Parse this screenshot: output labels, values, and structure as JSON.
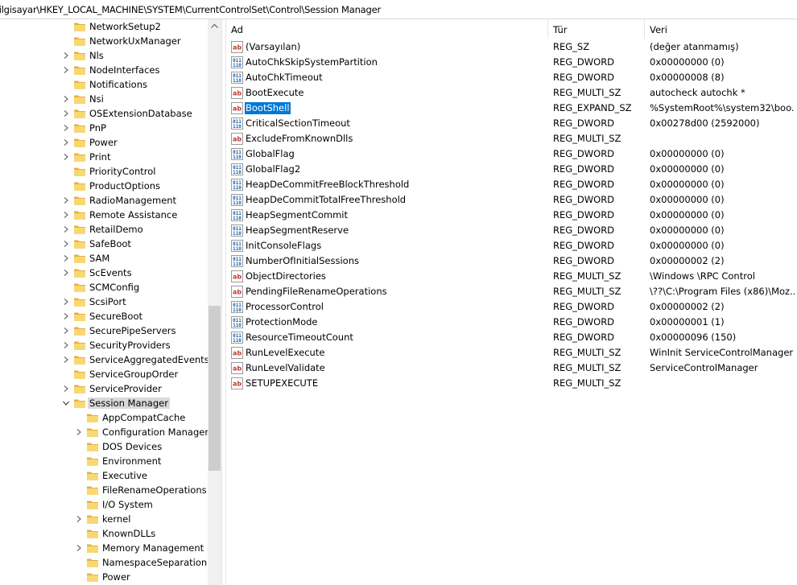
{
  "address": "Bilgisayar\\HKEY_LOCAL_MACHINE\\SYSTEM\\CurrentControlSet\\Control\\Session Manager",
  "tree": [
    {
      "label": "NetworkSetup2",
      "chev": "none",
      "lvl": 0
    },
    {
      "label": "NetworkUxManager",
      "chev": "none",
      "lvl": 0
    },
    {
      "label": "Nls",
      "chev": "right",
      "lvl": 0
    },
    {
      "label": "NodeInterfaces",
      "chev": "right",
      "lvl": 0
    },
    {
      "label": "Notifications",
      "chev": "none",
      "lvl": 0
    },
    {
      "label": "Nsi",
      "chev": "right",
      "lvl": 0
    },
    {
      "label": "OSExtensionDatabase",
      "chev": "right",
      "lvl": 0
    },
    {
      "label": "PnP",
      "chev": "right",
      "lvl": 0
    },
    {
      "label": "Power",
      "chev": "right",
      "lvl": 0
    },
    {
      "label": "Print",
      "chev": "right",
      "lvl": 0
    },
    {
      "label": "PriorityControl",
      "chev": "none",
      "lvl": 0
    },
    {
      "label": "ProductOptions",
      "chev": "none",
      "lvl": 0
    },
    {
      "label": "RadioManagement",
      "chev": "right",
      "lvl": 0
    },
    {
      "label": "Remote Assistance",
      "chev": "right",
      "lvl": 0
    },
    {
      "label": "RetailDemo",
      "chev": "right",
      "lvl": 0
    },
    {
      "label": "SafeBoot",
      "chev": "right",
      "lvl": 0
    },
    {
      "label": "SAM",
      "chev": "right",
      "lvl": 0
    },
    {
      "label": "ScEvents",
      "chev": "right",
      "lvl": 0
    },
    {
      "label": "SCMConfig",
      "chev": "none",
      "lvl": 0
    },
    {
      "label": "ScsiPort",
      "chev": "right",
      "lvl": 0
    },
    {
      "label": "SecureBoot",
      "chev": "right",
      "lvl": 0
    },
    {
      "label": "SecurePipeServers",
      "chev": "right",
      "lvl": 0
    },
    {
      "label": "SecurityProviders",
      "chev": "right",
      "lvl": 0
    },
    {
      "label": "ServiceAggregatedEvents",
      "chev": "right",
      "lvl": 0
    },
    {
      "label": "ServiceGroupOrder",
      "chev": "none",
      "lvl": 0
    },
    {
      "label": "ServiceProvider",
      "chev": "right",
      "lvl": 0
    },
    {
      "label": "Session Manager",
      "chev": "down",
      "lvl": 0,
      "selected": true
    },
    {
      "label": "AppCompatCache",
      "chev": "none",
      "lvl": 1
    },
    {
      "label": "Configuration Manager",
      "chev": "right",
      "lvl": 1
    },
    {
      "label": "DOS Devices",
      "chev": "none",
      "lvl": 1
    },
    {
      "label": "Environment",
      "chev": "none",
      "lvl": 1
    },
    {
      "label": "Executive",
      "chev": "none",
      "lvl": 1
    },
    {
      "label": "FileRenameOperations",
      "chev": "none",
      "lvl": 1
    },
    {
      "label": "I/O System",
      "chev": "none",
      "lvl": 1
    },
    {
      "label": "kernel",
      "chev": "right",
      "lvl": 1
    },
    {
      "label": "KnownDLLs",
      "chev": "none",
      "lvl": 1
    },
    {
      "label": "Memory Management",
      "chev": "right",
      "lvl": 1
    },
    {
      "label": "NamespaceSeparation",
      "chev": "none",
      "lvl": 1
    },
    {
      "label": "Power",
      "chev": "none",
      "lvl": 1
    }
  ],
  "columns": {
    "name": "Ad",
    "type": "Tür",
    "data": "Veri"
  },
  "values": [
    {
      "icon": "ab",
      "name": "(Varsayılan)",
      "type": "REG_SZ",
      "data": "(değer atanmamış)"
    },
    {
      "icon": "bin",
      "name": "AutoChkSkipSystemPartition",
      "type": "REG_DWORD",
      "data": "0x00000000 (0)"
    },
    {
      "icon": "bin",
      "name": "AutoChkTimeout",
      "type": "REG_DWORD",
      "data": "0x00000008 (8)"
    },
    {
      "icon": "ab",
      "name": "BootExecute",
      "type": "REG_MULTI_SZ",
      "data": "autocheck autochk *"
    },
    {
      "icon": "ab",
      "name": "BootShell",
      "type": "REG_EXPAND_SZ",
      "data": "%SystemRoot%\\system32\\boo...",
      "selected": true
    },
    {
      "icon": "bin",
      "name": "CriticalSectionTimeout",
      "type": "REG_DWORD",
      "data": "0x00278d00 (2592000)"
    },
    {
      "icon": "ab",
      "name": "ExcludeFromKnownDlls",
      "type": "REG_MULTI_SZ",
      "data": ""
    },
    {
      "icon": "bin",
      "name": "GlobalFlag",
      "type": "REG_DWORD",
      "data": "0x00000000 (0)"
    },
    {
      "icon": "bin",
      "name": "GlobalFlag2",
      "type": "REG_DWORD",
      "data": "0x00000000 (0)"
    },
    {
      "icon": "bin",
      "name": "HeapDeCommitFreeBlockThreshold",
      "type": "REG_DWORD",
      "data": "0x00000000 (0)"
    },
    {
      "icon": "bin",
      "name": "HeapDeCommitTotalFreeThreshold",
      "type": "REG_DWORD",
      "data": "0x00000000 (0)"
    },
    {
      "icon": "bin",
      "name": "HeapSegmentCommit",
      "type": "REG_DWORD",
      "data": "0x00000000 (0)"
    },
    {
      "icon": "bin",
      "name": "HeapSegmentReserve",
      "type": "REG_DWORD",
      "data": "0x00000000 (0)"
    },
    {
      "icon": "bin",
      "name": "InitConsoleFlags",
      "type": "REG_DWORD",
      "data": "0x00000000 (0)"
    },
    {
      "icon": "bin",
      "name": "NumberOfInitialSessions",
      "type": "REG_DWORD",
      "data": "0x00000002 (2)"
    },
    {
      "icon": "ab",
      "name": "ObjectDirectories",
      "type": "REG_MULTI_SZ",
      "data": "\\Windows \\RPC Control"
    },
    {
      "icon": "ab",
      "name": "PendingFileRenameOperations",
      "type": "REG_MULTI_SZ",
      "data": "\\??\\C:\\Program Files (x86)\\Moz..."
    },
    {
      "icon": "bin",
      "name": "ProcessorControl",
      "type": "REG_DWORD",
      "data": "0x00000002 (2)"
    },
    {
      "icon": "bin",
      "name": "ProtectionMode",
      "type": "REG_DWORD",
      "data": "0x00000001 (1)"
    },
    {
      "icon": "bin",
      "name": "ResourceTimeoutCount",
      "type": "REG_DWORD",
      "data": "0x00000096 (150)"
    },
    {
      "icon": "ab",
      "name": "RunLevelExecute",
      "type": "REG_MULTI_SZ",
      "data": "WinInit ServiceControlManager"
    },
    {
      "icon": "ab",
      "name": "RunLevelValidate",
      "type": "REG_MULTI_SZ",
      "data": "ServiceControlManager"
    },
    {
      "icon": "ab",
      "name": "SETUPEXECUTE",
      "type": "REG_MULTI_SZ",
      "data": ""
    }
  ]
}
